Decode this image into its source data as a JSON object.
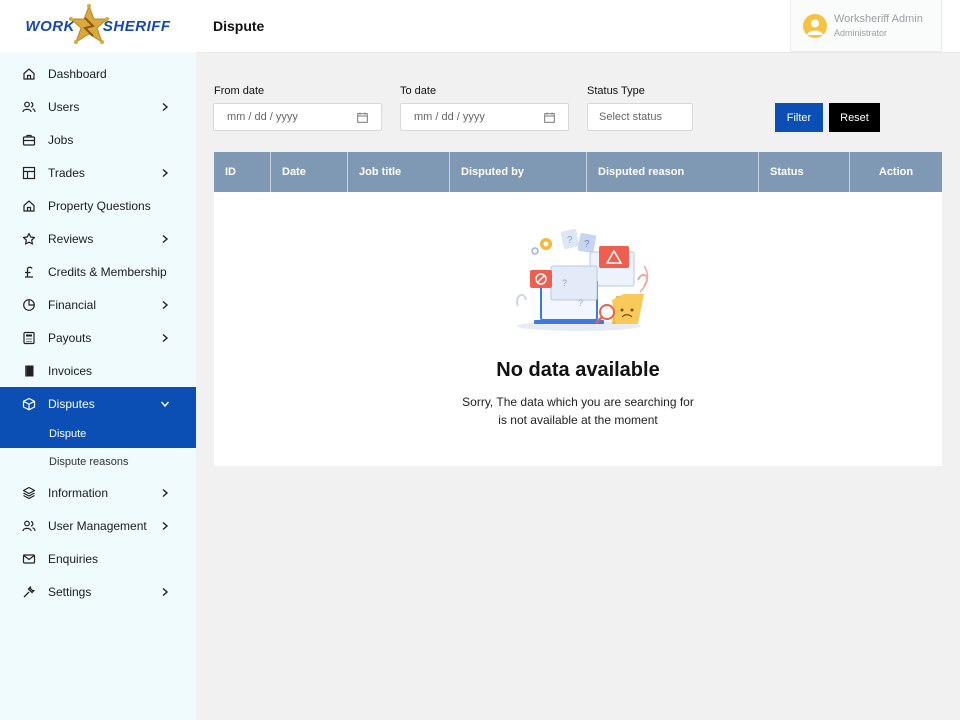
{
  "brand": {
    "word1": "WORK",
    "word2": "SHERIFF"
  },
  "header": {
    "title": "Dispute"
  },
  "user": {
    "name": "Worksheriff Admin",
    "role": "Administrator"
  },
  "sidebar": {
    "items": [
      {
        "label": "Dashboard",
        "icon": "home-icon",
        "has_chevron": false
      },
      {
        "label": "Users",
        "icon": "users-icon",
        "has_chevron": true
      },
      {
        "label": "Jobs",
        "icon": "briefcase-icon",
        "has_chevron": false
      },
      {
        "label": "Trades",
        "icon": "grid-icon",
        "has_chevron": true
      },
      {
        "label": "Property Questions",
        "icon": "home-icon",
        "has_chevron": false
      },
      {
        "label": "Reviews",
        "icon": "star-icon",
        "has_chevron": true
      },
      {
        "label": "Credits & Membership",
        "icon": "pound-icon",
        "has_chevron": false
      },
      {
        "label": "Financial",
        "icon": "pie-chart-icon",
        "has_chevron": true
      },
      {
        "label": "Payouts",
        "icon": "calculator-icon",
        "has_chevron": true
      },
      {
        "label": "Invoices",
        "icon": "book-icon",
        "has_chevron": false
      },
      {
        "label": "Disputes",
        "icon": "box-icon",
        "has_chevron": true
      },
      {
        "label": "Information",
        "icon": "layers-icon",
        "has_chevron": true
      },
      {
        "label": "User Management",
        "icon": "users-icon",
        "has_chevron": true
      },
      {
        "label": "Enquiries",
        "icon": "mail-icon",
        "has_chevron": false
      },
      {
        "label": "Settings",
        "icon": "tool-icon",
        "has_chevron": true
      }
    ],
    "subitems": [
      {
        "label": "Dispute"
      },
      {
        "label": "Dispute reasons"
      }
    ]
  },
  "filters": {
    "from_label": "From date",
    "from_placeholder": "mm / dd / yyyy",
    "to_label": "To date",
    "to_placeholder": "mm / dd / yyyy",
    "status_label": "Status Type",
    "status_placeholder": "Select status",
    "filter_button": "Filter",
    "reset_button": "Reset"
  },
  "table": {
    "columns": [
      "ID",
      "Date",
      "Job title",
      "Disputed by",
      "Disputed reason",
      "Status",
      "Action"
    ],
    "rows": []
  },
  "empty_state": {
    "title": "No data available",
    "line1": "Sorry, The data which you are searching for",
    "line2": "is not available at the moment"
  },
  "colors": {
    "accent": "#0b4fb5",
    "table_header": "#7f98b4",
    "sidebar_bg": "#effbfc",
    "reset": "#000000"
  }
}
